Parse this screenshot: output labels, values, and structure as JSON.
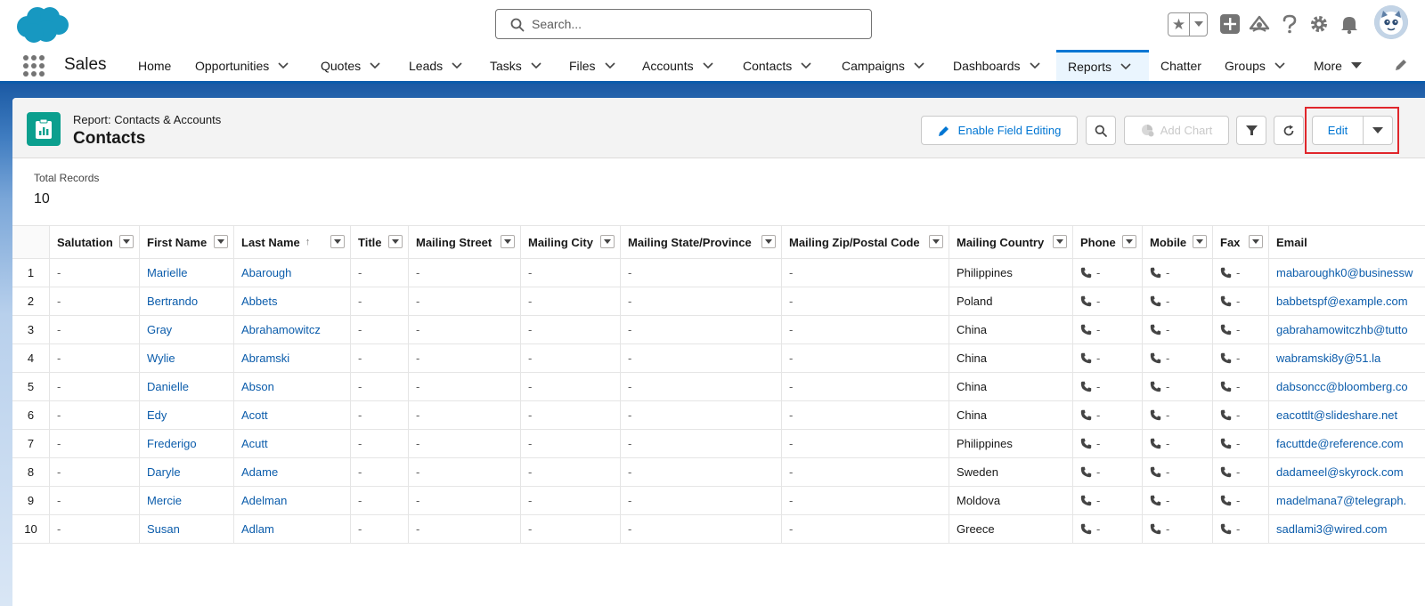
{
  "search": {
    "placeholder": "Search..."
  },
  "nav": {
    "app_name": "Sales",
    "items": [
      {
        "label": "Home",
        "has_menu": false
      },
      {
        "label": "Opportunities",
        "has_menu": true
      },
      {
        "label": "Quotes",
        "has_menu": true
      },
      {
        "label": "Leads",
        "has_menu": true
      },
      {
        "label": "Tasks",
        "has_menu": true
      },
      {
        "label": "Files",
        "has_menu": true
      },
      {
        "label": "Accounts",
        "has_menu": true
      },
      {
        "label": "Contacts",
        "has_menu": true
      },
      {
        "label": "Campaigns",
        "has_menu": true
      },
      {
        "label": "Dashboards",
        "has_menu": true
      },
      {
        "label": "Reports",
        "has_menu": true,
        "active": true
      },
      {
        "label": "Chatter",
        "has_menu": false
      },
      {
        "label": "Groups",
        "has_menu": true
      },
      {
        "label": "More",
        "has_menu": true
      }
    ]
  },
  "report": {
    "type_label": "Report: Contacts & Accounts",
    "title": "Contacts",
    "buttons": {
      "enable_field_editing": "Enable Field Editing",
      "add_chart": "Add Chart",
      "edit": "Edit"
    },
    "total_records_label": "Total Records",
    "total_records_value": "10"
  },
  "table": {
    "columns": [
      "Salutation",
      "First Name",
      "Last Name",
      "Title",
      "Mailing Street",
      "Mailing City",
      "Mailing State/Province",
      "Mailing Zip/Postal Code",
      "Mailing Country",
      "Phone",
      "Mobile",
      "Fax",
      "Email"
    ],
    "rows": [
      {
        "n": "1",
        "salutation": "-",
        "first": "Marielle",
        "last": "Abarough",
        "title": "-",
        "street": "-",
        "city": "-",
        "state": "-",
        "zip": "-",
        "country": "Philippines",
        "phone": "-",
        "mobile": "-",
        "fax": "-",
        "email": "mabaroughk0@businessw"
      },
      {
        "n": "2",
        "salutation": "-",
        "first": "Bertrando",
        "last": "Abbets",
        "title": "-",
        "street": "-",
        "city": "-",
        "state": "-",
        "zip": "-",
        "country": "Poland",
        "phone": "-",
        "mobile": "-",
        "fax": "-",
        "email": "babbetspf@example.com"
      },
      {
        "n": "3",
        "salutation": "-",
        "first": "Gray",
        "last": "Abrahamowitcz",
        "title": "-",
        "street": "-",
        "city": "-",
        "state": "-",
        "zip": "-",
        "country": "China",
        "phone": "-",
        "mobile": "-",
        "fax": "-",
        "email": "gabrahamowitczhb@tutto"
      },
      {
        "n": "4",
        "salutation": "-",
        "first": "Wylie",
        "last": "Abramski",
        "title": "-",
        "street": "-",
        "city": "-",
        "state": "-",
        "zip": "-",
        "country": "China",
        "phone": "-",
        "mobile": "-",
        "fax": "-",
        "email": "wabramski8y@51.la"
      },
      {
        "n": "5",
        "salutation": "-",
        "first": "Danielle",
        "last": "Abson",
        "title": "-",
        "street": "-",
        "city": "-",
        "state": "-",
        "zip": "-",
        "country": "China",
        "phone": "-",
        "mobile": "-",
        "fax": "-",
        "email": "dabsoncc@bloomberg.co"
      },
      {
        "n": "6",
        "salutation": "-",
        "first": "Edy",
        "last": "Acott",
        "title": "-",
        "street": "-",
        "city": "-",
        "state": "-",
        "zip": "-",
        "country": "China",
        "phone": "-",
        "mobile": "-",
        "fax": "-",
        "email": "eacottlt@slideshare.net"
      },
      {
        "n": "7",
        "salutation": "-",
        "first": "Frederigo",
        "last": "Acutt",
        "title": "-",
        "street": "-",
        "city": "-",
        "state": "-",
        "zip": "-",
        "country": "Philippines",
        "phone": "-",
        "mobile": "-",
        "fax": "-",
        "email": "facuttde@reference.com"
      },
      {
        "n": "8",
        "salutation": "-",
        "first": "Daryle",
        "last": "Adame",
        "title": "-",
        "street": "-",
        "city": "-",
        "state": "-",
        "zip": "-",
        "country": "Sweden",
        "phone": "-",
        "mobile": "-",
        "fax": "-",
        "email": "dadameel@skyrock.com"
      },
      {
        "n": "9",
        "salutation": "-",
        "first": "Mercie",
        "last": "Adelman",
        "title": "-",
        "street": "-",
        "city": "-",
        "state": "-",
        "zip": "-",
        "country": "Moldova",
        "phone": "-",
        "mobile": "-",
        "fax": "-",
        "email": "madelmana7@telegraph."
      },
      {
        "n": "10",
        "salutation": "-",
        "first": "Susan",
        "last": "Adlam",
        "title": "-",
        "street": "-",
        "city": "-",
        "state": "-",
        "zip": "-",
        "country": "Greece",
        "phone": "-",
        "mobile": "-",
        "fax": "-",
        "email": "sadlami3@wired.com"
      }
    ]
  },
  "colors": {
    "brand_blue": "#0176d3",
    "link_blue": "#0b5cab",
    "report_icon": "#0b9f8e",
    "highlight_red": "#e0262b"
  },
  "icons": [
    "salesforce-cloud-logo",
    "search-icon",
    "favorites-star-icon",
    "global-add-icon",
    "trailhead-icon",
    "help-icon",
    "setup-gear-icon",
    "notifications-bell-icon",
    "avatar",
    "app-launcher-icon",
    "edit-nav-pencil-icon",
    "report-icon",
    "pencil-icon",
    "search-icon",
    "add-chart-icon",
    "filter-icon",
    "refresh-icon",
    "dropdown-chevron-icon",
    "phone-icon"
  ]
}
